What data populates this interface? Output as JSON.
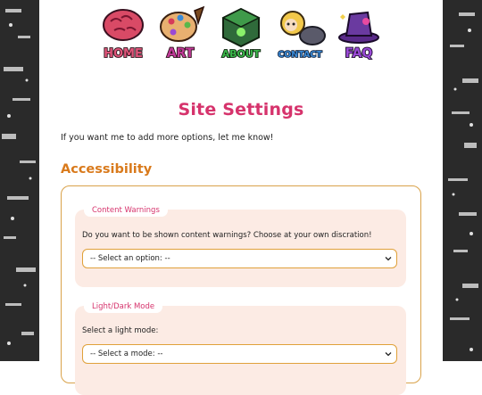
{
  "nav": {
    "items": [
      {
        "label": "HOME",
        "icon": "brain-icon"
      },
      {
        "label": "ART",
        "icon": "palette-icon"
      },
      {
        "label": "ABOUT",
        "icon": "cube-icon"
      },
      {
        "label": "CONTACT",
        "icon": "character-icon"
      },
      {
        "label": "FAQ",
        "icon": "hat-icon"
      }
    ]
  },
  "page": {
    "title": "Site Settings",
    "intro": "If you want me to add more options, let me know!"
  },
  "accessibility": {
    "heading": "Accessibility",
    "content_warnings": {
      "tag": "Content Warnings",
      "prompt": "Do you want to be shown content warnings? Choose at your own discration!",
      "select_value": "-- Select an option: --"
    },
    "light_dark": {
      "tag": "Light/Dark Mode",
      "prompt": "Select a light mode:",
      "select_value": "-- Select a mode: --"
    }
  },
  "colors": {
    "title": "#d6336c",
    "heading": "#d97a1c",
    "card_bg": "#fcebe4",
    "select_border": "#e0a13a"
  }
}
